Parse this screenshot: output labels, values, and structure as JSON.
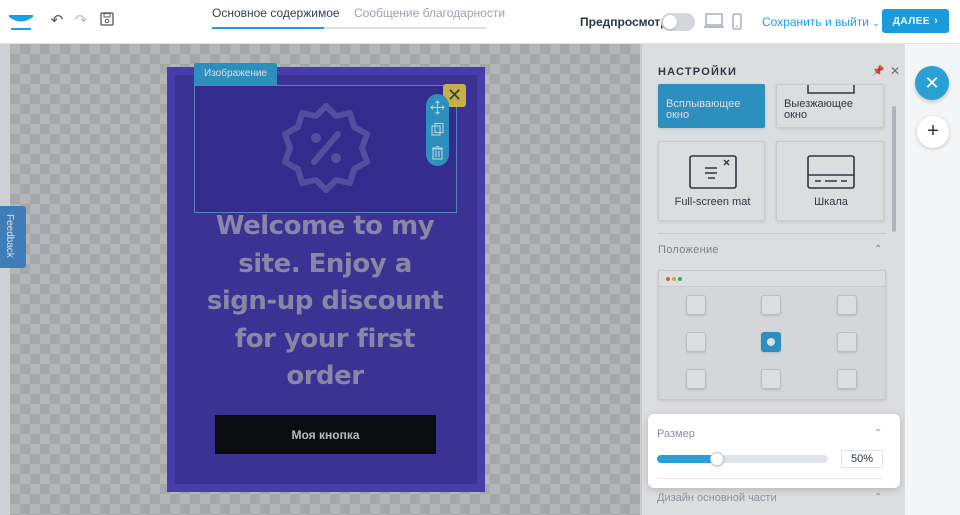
{
  "tabs": [
    {
      "label": "Основное содержимое",
      "active": true
    },
    {
      "label": "Сообщение благодарности",
      "active": false
    }
  ],
  "toolbar": {
    "preview_label": "Предпросмотр",
    "preview_on": false,
    "save_exit_label": "Сохранить и выйти",
    "next_label": "ДАЛЕЕ"
  },
  "canvas": {
    "feedback_label": "Feedback",
    "image_label": "Изображение",
    "headline": "Welcome to my site. Enjoy a sign-up discount for your first order",
    "button_label": "Моя кнопка"
  },
  "settings": {
    "title": "НАСТРОЙКИ",
    "layouts": [
      {
        "label": "Всплывающее окно",
        "selected": true
      },
      {
        "label": "Выезжающее окно",
        "selected": false
      },
      {
        "label": "Full-screen mat",
        "selected": false
      },
      {
        "label": "Шкала",
        "selected": false
      }
    ],
    "position_label": "Положение",
    "position_selected": "middle-center",
    "size_label": "Размер",
    "size_value": "50%",
    "size_fraction": 0.35,
    "design_label": "Дизайн основной части"
  },
  "colors": {
    "accent": "#1a9bdc",
    "popup_bg": "#3b2fa3",
    "close_btn": "#e3c84a"
  }
}
